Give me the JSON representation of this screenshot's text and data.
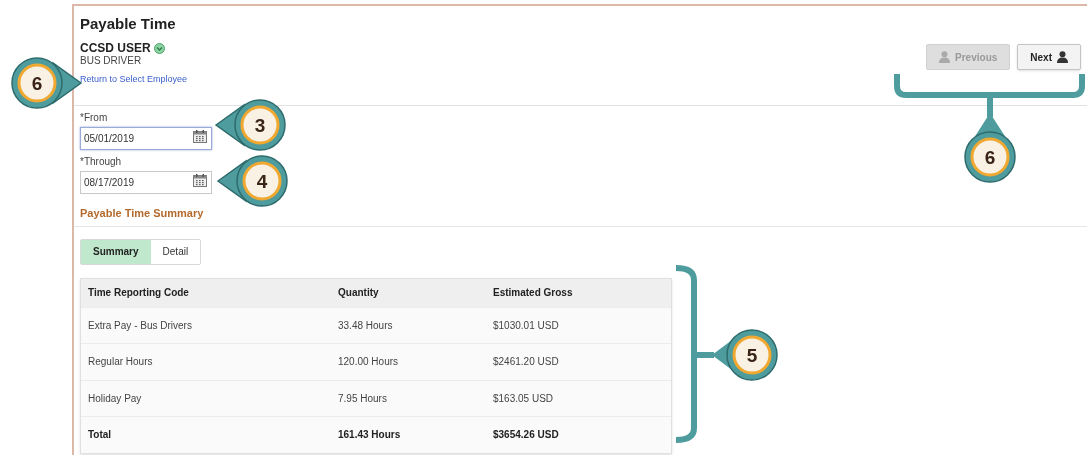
{
  "page": {
    "title": "Payable Time"
  },
  "employee": {
    "name": "CCSD USER",
    "job": "BUS DRIVER",
    "link": "Return to Select Employee"
  },
  "nav_buttons": [
    {
      "label": "Previous",
      "disabled": true,
      "kind": "icon-first"
    },
    {
      "label": "Next",
      "disabled": false,
      "kind": "icon-last"
    }
  ],
  "fields": [
    {
      "label": "*From",
      "value": "05/01/2019",
      "focused": true
    },
    {
      "label": "*Through",
      "value": "08/17/2019",
      "focused": false
    }
  ],
  "section_title": "Payable Time Summary",
  "tabs": [
    {
      "label": "Summary",
      "selected": true
    },
    {
      "label": "Detail",
      "selected": false
    }
  ],
  "table": {
    "columns": [
      "Time Reporting Code",
      "Quantity",
      "Estimated Gross"
    ],
    "rows": [
      {
        "kind": "item",
        "cells": [
          "Extra Pay - Bus Drivers",
          "33.48 Hours",
          "$1030.01 USD"
        ]
      },
      {
        "kind": "item",
        "cells": [
          "Regular Hours",
          "120.00 Hours",
          "$2461.20 USD"
        ]
      },
      {
        "kind": "item",
        "cells": [
          "Holiday Pay",
          "7.95 Hours",
          "$163.05 USD"
        ]
      },
      {
        "kind": "total",
        "cells": [
          "Total",
          "161.43 Hours",
          "$3654.26 USD"
        ]
      }
    ]
  },
  "callouts": [
    {
      "number": "6",
      "kind": "pointer-right"
    },
    {
      "number": "3",
      "kind": "pointer-left"
    },
    {
      "number": "4",
      "kind": "pointer-left"
    },
    {
      "number": "5",
      "kind": "bracket-left"
    },
    {
      "number": "6",
      "kind": "bracket-up"
    }
  ]
}
